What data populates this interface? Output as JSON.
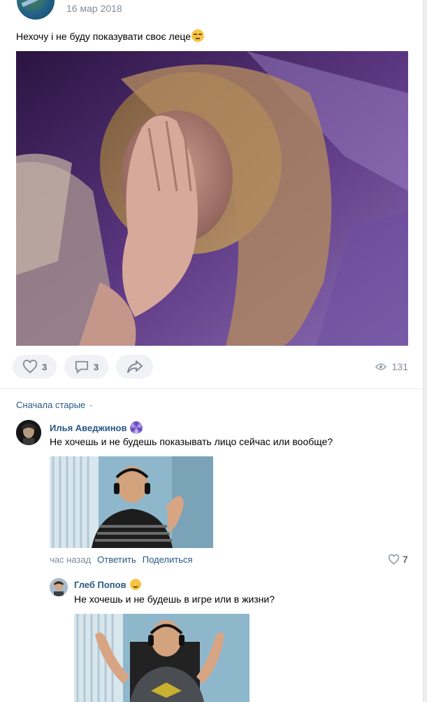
{
  "post": {
    "date": "16 мар 2018",
    "text": "Нехочу і не буду показувати своє леце",
    "emoji": "relieved-face-emoji",
    "likes": "3",
    "comments": "3",
    "views": "131"
  },
  "comments_section": {
    "sort_label": "Сначала старые"
  },
  "comments": [
    {
      "author": "Илья Аведжинов",
      "badge": "spiral-badge-icon",
      "text": "Не хочешь и не будешь показывать лицо сейчас или вообще?",
      "time": "час назад",
      "reply_label": "Ответить",
      "share_label": "Поделиться",
      "likes": "7"
    },
    {
      "author": "Глеб Попов",
      "badge": "smile-emoji",
      "text": "Не хочешь и не будешь в игре или в жизни?"
    }
  ],
  "colors": {
    "link": "#2a5885",
    "muted": "#818c99",
    "pill_bg": "#f0f2f5"
  }
}
